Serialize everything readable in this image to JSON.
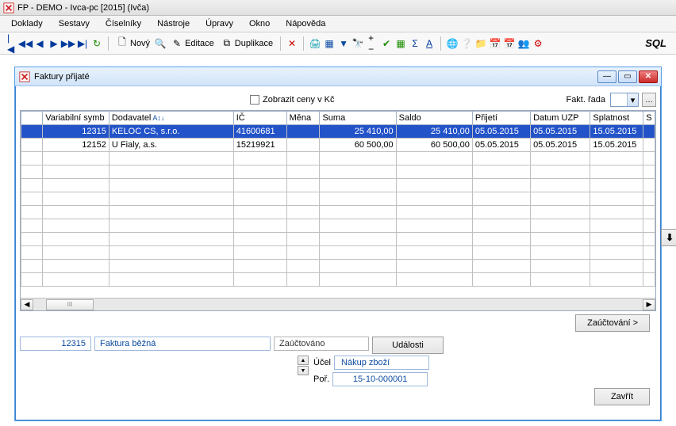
{
  "title": "FP - DEMO - Ivca-pc [2015]  (Ivča)",
  "menu": [
    "Doklady",
    "Sestavy",
    "Číselníky",
    "Nástroje",
    "Úpravy",
    "Okno",
    "Nápověda"
  ],
  "toolbar": {
    "new": "Nový",
    "edit": "Editace",
    "dup": "Duplikace",
    "sql": "SQL"
  },
  "child": {
    "title": "Faktury přijaté",
    "show_prices": "Zobrazit ceny v Kč",
    "fakt_rada_label": "Fakt. řada",
    "fakt_rada_value": "",
    "columns": [
      "",
      "Variabilní symb",
      "Dodavatel",
      "IČ",
      "Měna",
      "Suma",
      "Saldo",
      "Přijetí",
      "Datum UZP",
      "Splatnost",
      "S"
    ],
    "rows": [
      {
        "vs": "12315",
        "dod": "KELOC CS, s.r.o.",
        "ic": "41600681",
        "mena": "",
        "suma": "25 410,00",
        "saldo": "25 410,00",
        "prij": "05.05.2015",
        "uzp": "05.05.2015",
        "spl": "15.05.2015"
      },
      {
        "vs": "12152",
        "dod": "U Fialy, a.s.",
        "ic": "15219921",
        "mena": "",
        "suma": "60 500,00",
        "saldo": "60 500,00",
        "prij": "05.05.2015",
        "uzp": "05.05.2015",
        "spl": "15.05.2015"
      }
    ],
    "book_btn": "Zaúčtování >",
    "events_btn": "Události",
    "close_btn": "Zavřít",
    "info": {
      "vs": "12315",
      "type": "Faktura běžná",
      "booked": "Zaúčtováno",
      "ucel_label": "Účel",
      "ucel": "Nákup zboží",
      "por_label": "Poř.",
      "por": "15-10-000001"
    }
  }
}
